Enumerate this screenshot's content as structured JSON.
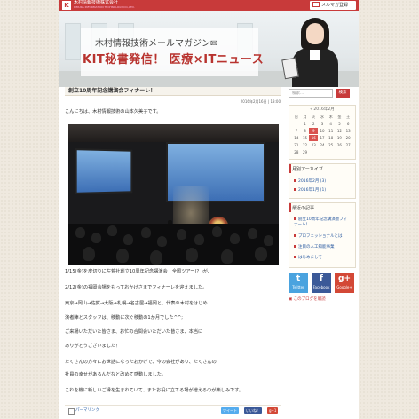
{
  "header": {
    "logo_letter": "K",
    "company": "木村情報技術株式会社",
    "company_sub": "KIMURA INFORMATION TECHNOLOGY CO.,LTD.",
    "mail_button": "メルマガ登録",
    "banner_subtitle": "木村情報技術メールマガジン✉",
    "banner_title": "KIT秘書発信！ 医療×ITニュース"
  },
  "post": {
    "title": "創立10周年記念講演会フィナーレ！",
    "date": "2016年2月16日 | 13:00",
    "greeting": "こんにちは、木村情報技術の山本久美子です。",
    "photo": {
      "screen_text_left": "",
      "screen_text_right": ""
    },
    "paragraphs": [
      "1/15(金)を皮切りに左賀社創立10周年記念講演会　全国ツアー(？)が、",
      "2/12(金)の福岡会場をもっておかげさまでフィナーレを迎えました。",
      "東京→岡山→佐賀→大阪→札幌→名古屋→福岡と、代表の木村をはじめ",
      "演者陣とスタッフは、移動に次ぐ移動の1か月でした^^;",
      "ご来場いただいた皆さま、お忙の合間会いただいた皆さま、本当に",
      "ありがとうございました！",
      "たくさんの方々にお世話になったおかげで、今の会社があり、たくさんの",
      "社員の幸せがあるんだなと改めて感動しました。",
      "これを機に新しいご縁を生まれていて、またお役に立てる場が増えるのが楽しみです。"
    ],
    "footer": {
      "permalink": "パーマリンク",
      "tweet": "ツイート",
      "like": "いいね！",
      "google": "g+1"
    }
  },
  "sidebar": {
    "search_placeholder": "検索...",
    "search_button": "検索",
    "calendar": {
      "title": "« 2016年2月",
      "weekdays": [
        "日",
        "月",
        "火",
        "水",
        "木",
        "金",
        "土"
      ],
      "days": [
        "",
        "1",
        "2",
        "3",
        "4",
        "5",
        "6",
        "7",
        "8",
        "9",
        "10",
        "11",
        "12",
        "13",
        "14",
        "15",
        "16",
        "17",
        "18",
        "19",
        "20",
        "21",
        "22",
        "23",
        "24",
        "25",
        "26",
        "27",
        "28",
        "29",
        "",
        "",
        "",
        "",
        ""
      ],
      "highlighted": [
        "9",
        "16"
      ]
    },
    "archive": {
      "title": "月別アーカイブ",
      "items": [
        "2016年2月 (3)",
        "2016年1月 (1)"
      ]
    },
    "recent": {
      "title": "最近の記事",
      "items": [
        "創立10周年記念講演会フィナーレ！",
        "プロフェッショナルとは",
        "注目の人工知能事業",
        "はじめまして"
      ]
    },
    "social": {
      "twitter": "Twitter",
      "facebook": "Facebook",
      "google": "Google+"
    },
    "rss": "このブログを購読"
  },
  "colors": {
    "accent": "#c83a3a",
    "link": "#2a5aa0",
    "twitter": "#4aa3df",
    "facebook": "#3b5998",
    "google": "#d34836"
  }
}
